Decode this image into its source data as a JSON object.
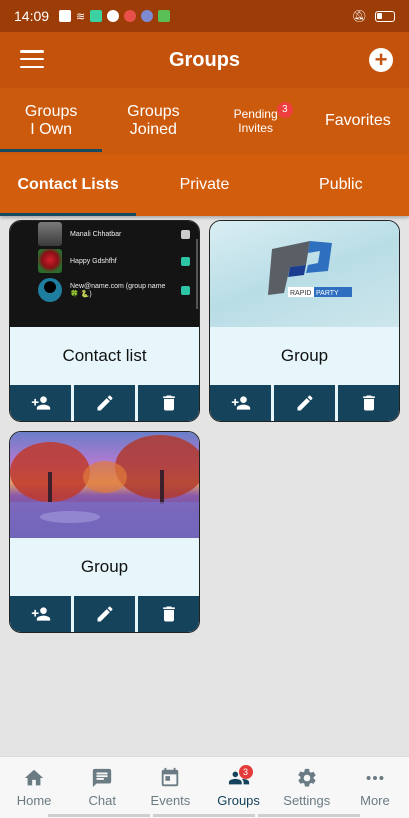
{
  "status_bar": {
    "time": "14:09"
  },
  "app_bar": {
    "title": "Groups",
    "add_symbol": "+"
  },
  "main_tabs": [
    {
      "line1": "Groups",
      "line2": "I Own",
      "active": true
    },
    {
      "line1": "Groups",
      "line2": "Joined",
      "active": false
    },
    {
      "line1": "Pending",
      "line2": "Invites",
      "badge": "3",
      "active": false
    },
    {
      "line1": "Favorites",
      "active": false
    }
  ],
  "sub_tabs": [
    {
      "label": "Contact Lists",
      "active": true
    },
    {
      "label": "Private",
      "active": false
    },
    {
      "label": "Public",
      "active": false
    }
  ],
  "cards": [
    {
      "title": "Contact list",
      "image": "contact-list-preview",
      "preview_rows": [
        {
          "name": "Manali Chhatbar",
          "check_color": "#cccccc"
        },
        {
          "name": "Happy Gdshfhf",
          "check_color": "#2ec4a6"
        },
        {
          "name": "New@name.com (group name",
          "sub": "🍀 🐍)",
          "check_color": "#2ec4a6"
        }
      ]
    },
    {
      "title": "Group",
      "image": "rapid-party-logo",
      "logo_text": "RAPID PARTY"
    },
    {
      "title": "Group",
      "image": "autumn-lake-landscape"
    }
  ],
  "card_actions": [
    "add-member",
    "edit",
    "delete"
  ],
  "bottom_nav": {
    "items": [
      {
        "label": "Home",
        "icon": "home-icon"
      },
      {
        "label": "Chat",
        "icon": "chat-icon"
      },
      {
        "label": "Events",
        "icon": "calendar-icon"
      },
      {
        "label": "Groups",
        "icon": "groups-icon",
        "badge": "3",
        "active": true
      },
      {
        "label": "Settings",
        "icon": "gear-icon"
      },
      {
        "label": "More",
        "icon": "more-icon"
      }
    ]
  },
  "colors": {
    "status_bar": "#9c3d07",
    "app_bar": "#c2520c",
    "tabs": "#cc5a0c",
    "accent_dark": "#16435c",
    "badge": "#ef3e3e"
  }
}
